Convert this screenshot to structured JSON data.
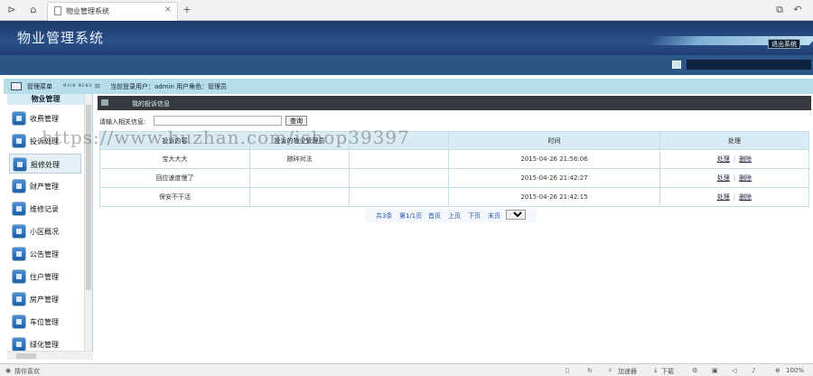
{
  "browser": {
    "tab_title": "物业管理系统",
    "tab_close": "×",
    "new_tab": "+"
  },
  "header": {
    "app_title": "物业管理系统",
    "logout_label": "退出系统"
  },
  "infobar": {
    "menu_title": "管理菜单",
    "menu_en": "MAIN MENU",
    "user_info": "当前登录用户：admin  用户角色：管理员"
  },
  "sidebar": {
    "heading": "物业管理",
    "items": [
      {
        "label": "收费管理"
      },
      {
        "label": "投诉处理"
      },
      {
        "label": "报修处理"
      },
      {
        "label": "财产管理"
      },
      {
        "label": "维修记录"
      },
      {
        "label": "小区概况"
      },
      {
        "label": "公告管理"
      },
      {
        "label": "住户管理"
      },
      {
        "label": "房产管理"
      },
      {
        "label": "车位管理"
      },
      {
        "label": "绿化管理"
      }
    ]
  },
  "main": {
    "panel_title": "我的投诉信息",
    "search_label": "请输入相关信息:",
    "search_value": "",
    "search_button": "查询",
    "columns": [
      "投诉内容",
      "投诉的物业管理员",
      "",
      "时间",
      "处理"
    ],
    "rows": [
      {
        "content": "宝大大大",
        "manager": "随碎对法",
        "time": "2015-04-26 21:56:06"
      },
      {
        "content": "回应速度慢了",
        "manager": "",
        "time": "2015-04-26 21:42:27"
      },
      {
        "content": "保安不干活",
        "manager": "",
        "time": "2015-04-26 21:42:15"
      }
    ],
    "action_process": "处理",
    "action_delete": "删除",
    "pager": {
      "total": "共3条",
      "page": "第1/1页",
      "first": "首页",
      "prev": "上页",
      "next": "下页",
      "last": "末页",
      "current": "1"
    }
  },
  "watermark": "https://www.huzhan.com/ishop39397",
  "statusbar": {
    "left": "猜你喜欢",
    "accelerator": "加速器",
    "download": "下载",
    "zoom": "100%"
  }
}
